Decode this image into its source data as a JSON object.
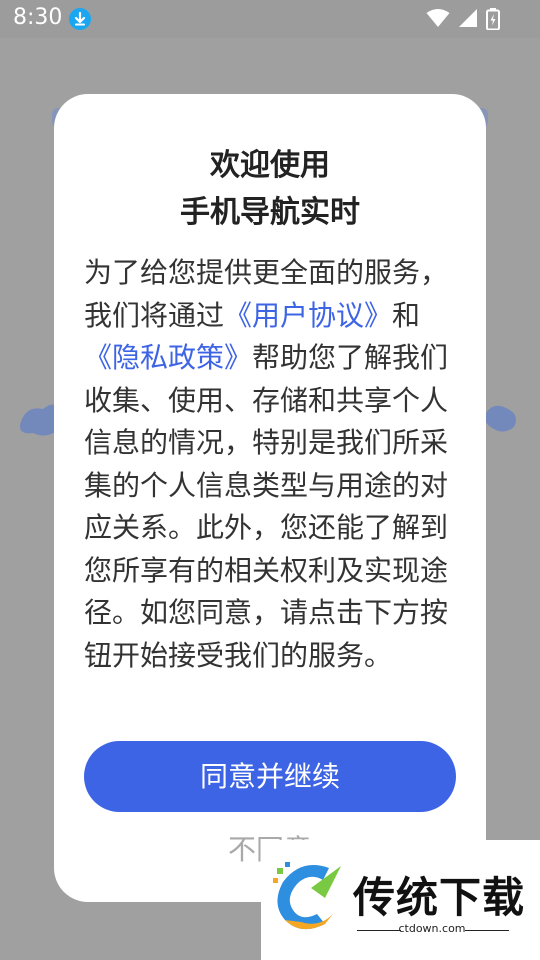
{
  "status_bar": {
    "time": "8:30",
    "icons": [
      "download-icon",
      "wifi-icon",
      "signal-icon",
      "battery-icon"
    ]
  },
  "dialog": {
    "title_line1": "欢迎使用",
    "title_line2": "手机导航实时",
    "body": {
      "part1": "为了给您提供更全面的服务，我们将通过",
      "link_user_agreement": "《用户协议》",
      "part2": "和",
      "link_privacy_policy": "《隐私政策》",
      "part3": "帮助您了解我们收集、使用、存储和共享个人信息的情况，特别是我们所采集的个人信息类型与用途的对应关系。此外，您还能了解到您所享有的相关权利及实现途径。如您同意，请点击下方按钮开始接受我们的服务。"
    },
    "agree_label": "同意并继续",
    "disagree_label": "不同意"
  },
  "watermark": {
    "brand": "传统下载",
    "url": "ctdown.com"
  },
  "colors": {
    "accent": "#3e64e6",
    "overlay": "#9c9c9c",
    "dialog_bg": "#ffffff",
    "disagree_text": "#a9a9a9"
  }
}
